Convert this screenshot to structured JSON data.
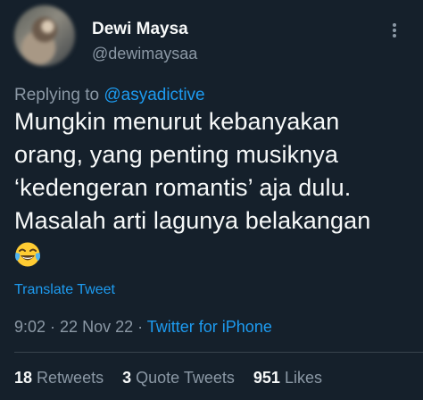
{
  "user": {
    "name": "Dewi Maysa",
    "handle": "@dewimaysaa"
  },
  "reply": {
    "prefix": "Replying to ",
    "mention": "@asyadictive"
  },
  "tweet": {
    "lines": [
      "Mungkin menurut kebanyakan",
      "orang, yang penting musiknya",
      "‘kedengeran romantis’ aja dulu.",
      "Masalah arti lagunya belakangan"
    ],
    "emoji": "face-with-tears-of-joy-icon"
  },
  "translate_label": "Translate Tweet",
  "meta": {
    "time": "9:02",
    "sep1": " · ",
    "date": "22 Nov 22",
    "sep2": " · ",
    "source": "Twitter for iPhone"
  },
  "stats": {
    "retweets_count": "18",
    "retweets_label": "Retweets",
    "quotes_count": "3",
    "quotes_label": "Quote Tweets",
    "likes_count": "951",
    "likes_label": "Likes"
  },
  "colors": {
    "background": "#15202b",
    "text": "#f7f9f9",
    "secondary": "#8b98a5",
    "accent": "#1d9bf0"
  }
}
